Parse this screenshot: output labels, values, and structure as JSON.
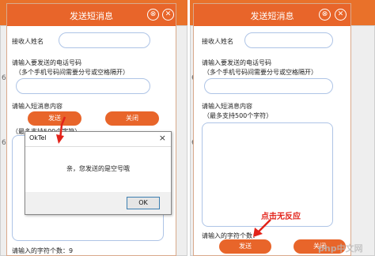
{
  "left_dialog": {
    "title": "发送短消息",
    "recipient_label": "接收人姓名",
    "phone_label": "请输入要发送的电话号码",
    "phone_hint": "（多个手机号码间需要分号或空格隔开）",
    "content_label": "请输入短消息内容",
    "send_label": "发送",
    "close_label": "关闭",
    "max_hint": "（最多支持500个字符）",
    "char_count_label": "请输入的字符个数：9"
  },
  "message_box": {
    "title": "OkTel",
    "message": "亲，您发送的是空号哦",
    "ok_label": "OK"
  },
  "right_dialog": {
    "title": "发送短消息",
    "recipient_label": "接收人姓名",
    "phone_label": "请输入要发送的电话号码",
    "phone_hint": "（多个手机号码间需要分号或空格隔开）",
    "content_label": "请输入短消息内容",
    "max_hint": "（最多支持500个字符）",
    "char_count_label": "请输入的字符个数：",
    "send_label": "发送",
    "close_label": "关闭"
  },
  "annotation": "点击无反应",
  "background_digits": [
    "6",
    "6",
    "6",
    "6"
  ],
  "watermark": "php中文网",
  "colors": {
    "accent": "#e8652a",
    "annotation": "#e2231a",
    "input_border": "#aec4e6"
  }
}
